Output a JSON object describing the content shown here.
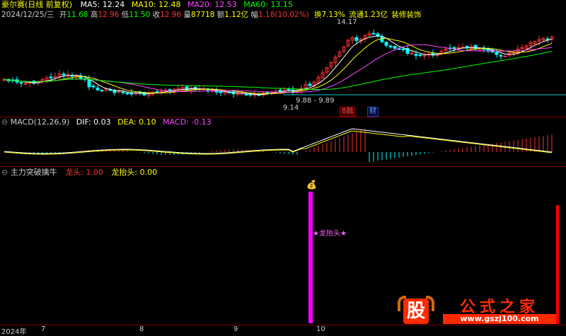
{
  "header": {
    "stock_name": "豪尔赛(日线 前复权)",
    "ma": [
      {
        "label": "MA5: 12.24",
        "color": "#ffffff"
      },
      {
        "label": "MA10: 12.48",
        "color": "#ffff00"
      },
      {
        "label": "MA20: 12.53",
        "color": "#ff44ff"
      },
      {
        "label": "MA60: 13.15",
        "color": "#00ff00"
      }
    ]
  },
  "info": {
    "date": "2024/12/25/三",
    "open_label": "开",
    "open": "11.68",
    "high_label": "高",
    "high": "12.96",
    "low_label": "低",
    "low": "11.50",
    "close_label": "收",
    "close": "12.96",
    "vol_label": "量",
    "vol": "87718",
    "amount_label": "额",
    "amount": "1.12亿",
    "chg_label": "幅",
    "chg": "1.18(10.02%)",
    "turnover": "换7.13%",
    "float": "流通1.23亿",
    "industry": "装修装饰"
  },
  "price_chart": {
    "high_marker": "14.17",
    "low_marker": "9.14",
    "gap_marker": "9.88 - 9.89",
    "tag_rong": "8融",
    "tag_cai": "财"
  },
  "macd": {
    "title": "MACD(12,26,9)",
    "dif": "DIF: 0.03",
    "dea": "DEA: 0.10",
    "macd": "MACD: -0.13"
  },
  "indicator": {
    "title": "主力突破擒牛",
    "longtou": "龙头: 1.00",
    "longtaitou": "龙抬头: 0.00",
    "annotation": "★龙抬头★",
    "icon": "money-bag-icon"
  },
  "time_axis": {
    "labels": [
      "2024年",
      "7",
      "8",
      "9",
      "10"
    ]
  },
  "watermark": {
    "logo_char": "股",
    "site_name": "公式之家",
    "site_url": "www.gszj100.com"
  },
  "colors": {
    "up": "#ff3030",
    "down": "#00ffff",
    "ma5": "#ffffff",
    "ma10": "#ffff00",
    "ma20": "#ff44ff",
    "ma60": "#00ff00",
    "indicator_bar": "#ff00ff",
    "longtou_bar": "#ff0000"
  }
}
